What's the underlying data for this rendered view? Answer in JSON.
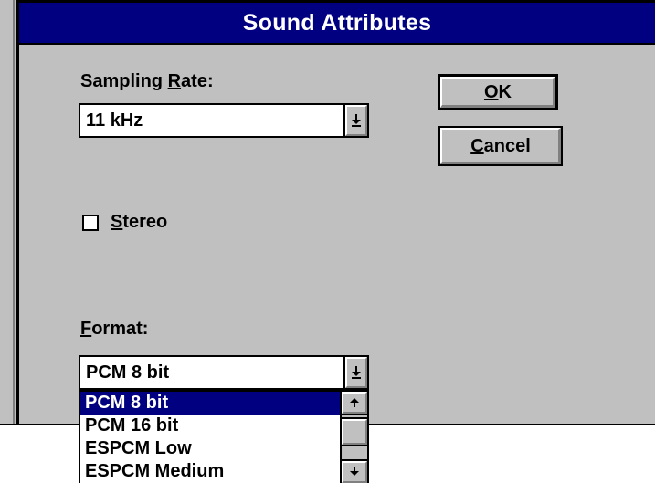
{
  "dialog": {
    "title": "Sound Attributes"
  },
  "sampling_rate": {
    "label_accel": "R",
    "label_pre": "Sampling ",
    "label_post": "ate:",
    "value": "11 kHz"
  },
  "buttons": {
    "ok_accel": "O",
    "ok_rest": "K",
    "cancel_accel": "C",
    "cancel_rest": "ancel"
  },
  "stereo": {
    "label_accel": "S",
    "label_rest": "tereo",
    "checked": false
  },
  "format": {
    "label_accel": "F",
    "label_rest": "ormat:",
    "value": "PCM 8 bit",
    "options": [
      {
        "label": "PCM 8 bit",
        "selected": true
      },
      {
        "label": "PCM 16 bit",
        "selected": false
      },
      {
        "label": "ESPCM Low",
        "selected": false
      },
      {
        "label": "ESPCM Medium",
        "selected": false
      }
    ]
  },
  "icons": {
    "dropdown": "arrow-down-bar-icon",
    "scroll_up": "arrow-up-icon",
    "scroll_down": "arrow-down-icon"
  },
  "colors": {
    "titlebar": "#000080",
    "face": "#c0c0c0",
    "selection": "#000080"
  }
}
